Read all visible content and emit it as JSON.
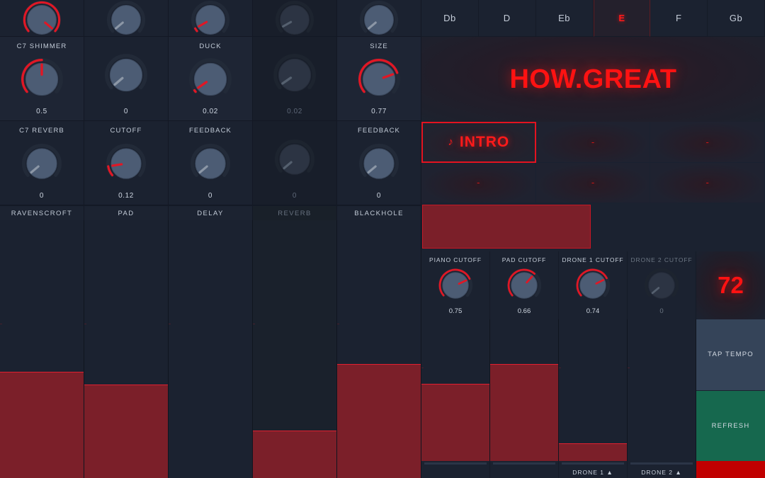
{
  "app": {
    "title": "HOW.GREAT",
    "accent_red": "#ff1212",
    "panel_bg": "#1b2230",
    "fill_red": "#7b1f29"
  },
  "notes": {
    "items": [
      {
        "label": "Db",
        "selected": false
      },
      {
        "label": "D",
        "selected": false
      },
      {
        "label": "Eb",
        "selected": false
      },
      {
        "label": "E",
        "selected": true
      },
      {
        "label": "F",
        "selected": false
      },
      {
        "label": "Gb",
        "selected": false
      }
    ]
  },
  "sections": {
    "items": [
      {
        "label": "INTRO",
        "icon": "♪",
        "active": true
      },
      {
        "label": "-",
        "icon": "",
        "active": false
      },
      {
        "label": "-",
        "icon": "",
        "active": false
      },
      {
        "label": "-",
        "icon": "",
        "active": false
      },
      {
        "label": "-",
        "icon": "",
        "active": false
      },
      {
        "label": "-",
        "icon": "",
        "active": false
      }
    ]
  },
  "progress": {
    "percent": 49
  },
  "tempo": {
    "value": "72",
    "tap_label": "TAP TEMPO",
    "refresh_label": "REFRESH"
  },
  "modules": {
    "names": [
      "RAVENSCROFT",
      "PAD",
      "DELAY",
      "REVERB",
      "BLACKHOLE"
    ],
    "enabled": [
      true,
      true,
      true,
      false,
      true
    ]
  },
  "knob_rows": [
    {
      "row": 0,
      "cells": [
        {
          "label": "",
          "value": "1",
          "norm": 1.0,
          "enabled": true
        },
        {
          "label": "",
          "value": "0",
          "norm": 0.0,
          "enabled": true
        },
        {
          "label": "",
          "value": "0.04",
          "norm": 0.04,
          "enabled": true
        },
        {
          "label": "",
          "value": "0.04",
          "norm": 0.04,
          "enabled": false
        },
        {
          "label": "",
          "value": "0",
          "norm": 0.0,
          "enabled": true
        }
      ]
    },
    {
      "row": 1,
      "cells": [
        {
          "label": "C7 SHIMMER",
          "value": "0.5",
          "norm": 0.5,
          "enabled": true
        },
        {
          "label": "",
          "value": "0",
          "norm": 0.0,
          "enabled": true
        },
        {
          "label": "DUCK",
          "value": "0.02",
          "norm": 0.02,
          "enabled": true
        },
        {
          "label": "",
          "value": "0.02",
          "norm": 0.02,
          "enabled": false
        },
        {
          "label": "SIZE",
          "value": "0.77",
          "norm": 0.77,
          "enabled": true
        }
      ]
    },
    {
      "row": 2,
      "cells": [
        {
          "label": "C7 REVERB",
          "value": "0",
          "norm": 0.0,
          "enabled": true
        },
        {
          "label": "CUTOFF",
          "value": "0.12",
          "norm": 0.12,
          "enabled": true
        },
        {
          "label": "FEEDBACK",
          "value": "0",
          "norm": 0.0,
          "enabled": true
        },
        {
          "label": "",
          "value": "0",
          "norm": 0.0,
          "enabled": false
        },
        {
          "label": "FEEDBACK",
          "value": "0",
          "norm": 0.0,
          "enabled": true
        }
      ]
    }
  ],
  "mixer_faders": [
    {
      "name": "RAVENSCROFT",
      "level": 0.41,
      "enabled": true
    },
    {
      "name": "PAD",
      "level": 0.36,
      "enabled": true
    },
    {
      "name": "DELAY",
      "level": 0.0,
      "enabled": true
    },
    {
      "name": "REVERB",
      "level": 0.18,
      "enabled": false
    },
    {
      "name": "BLACKHOLE",
      "level": 0.44,
      "enabled": true
    }
  ],
  "cutoffs": [
    {
      "label": "PIANO CUTOFF",
      "value": "0.75",
      "norm": 0.75,
      "enabled": true
    },
    {
      "label": "PAD CUTOFF",
      "value": "0.66",
      "norm": 0.66,
      "enabled": true
    },
    {
      "label": "DRONE 1 CUTOFF",
      "value": "0.74",
      "norm": 0.74,
      "enabled": true
    },
    {
      "label": "DRONE 2 CUTOFF",
      "value": "0",
      "norm": 0.0,
      "enabled": false
    }
  ],
  "voice_faders": [
    {
      "level": 0.54,
      "label": ""
    },
    {
      "level": 0.68,
      "label": ""
    },
    {
      "level": 0.12,
      "label": "DRONE 1 ▲"
    },
    {
      "level": 0.0,
      "label": "DRONE 2 ▲"
    }
  ]
}
